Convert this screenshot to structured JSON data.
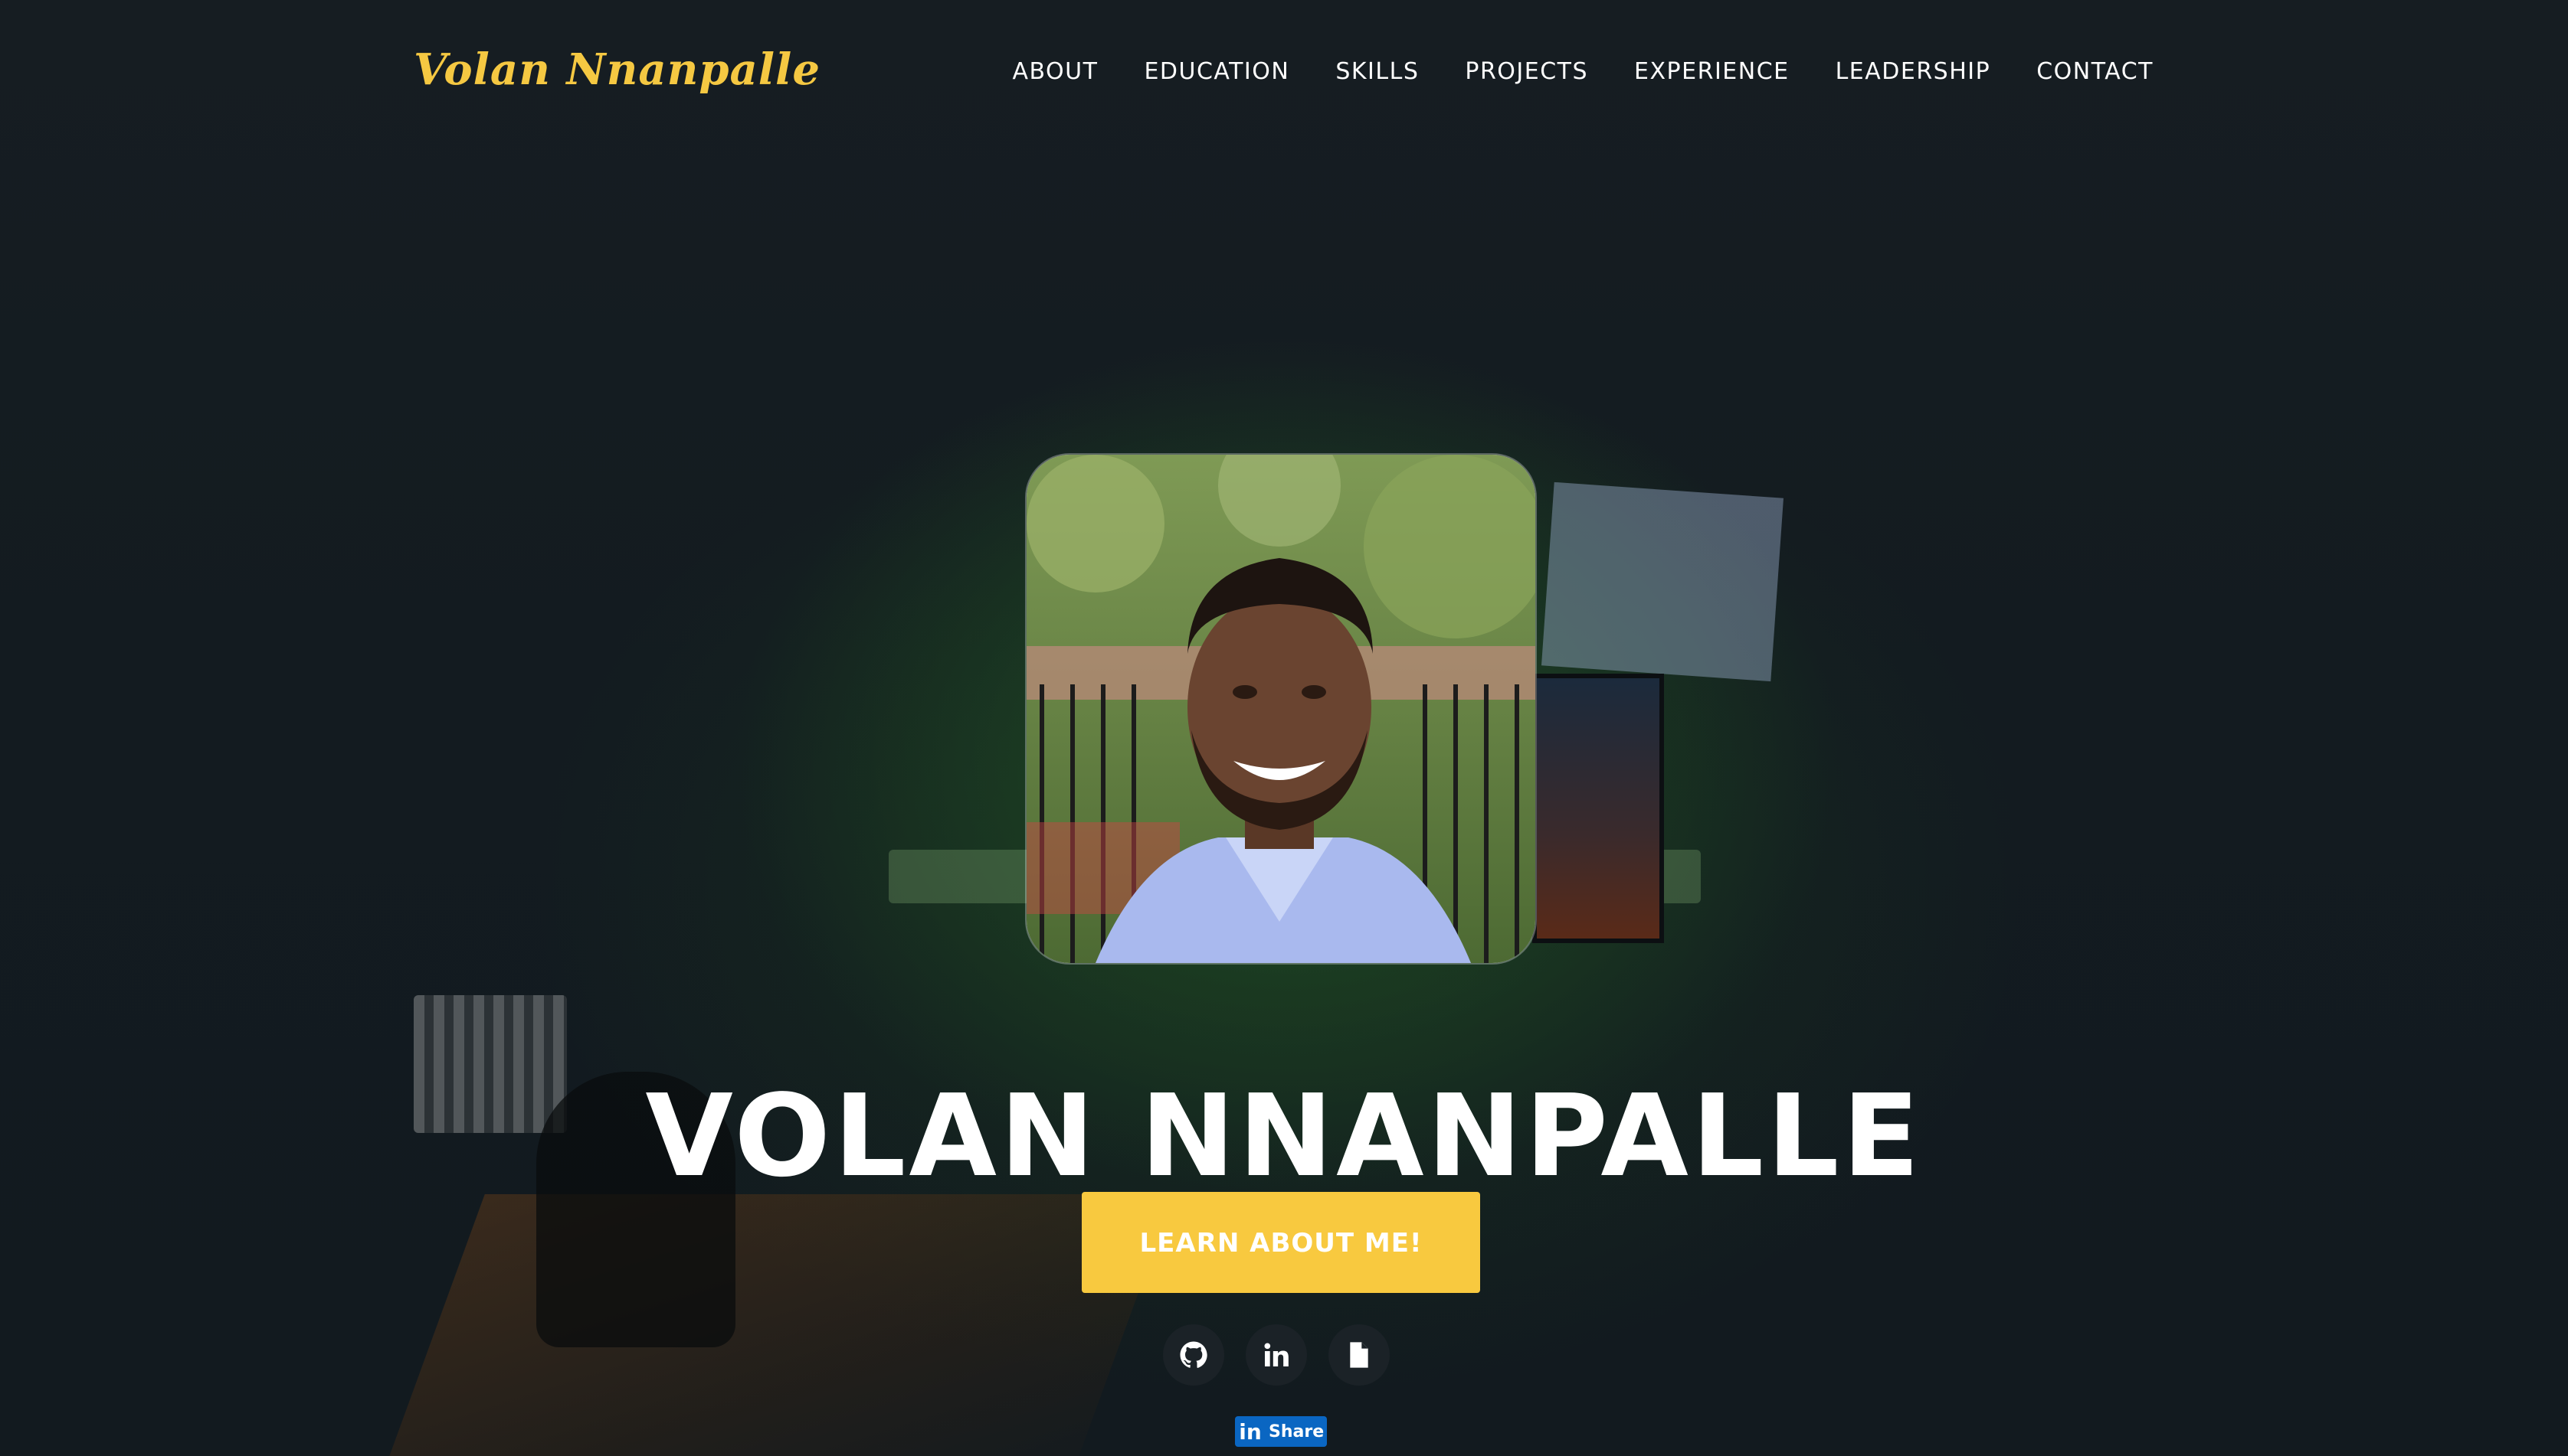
{
  "header": {
    "brand": "Volan Nnanpalle",
    "nav": [
      {
        "label": "ABOUT"
      },
      {
        "label": "EDUCATION"
      },
      {
        "label": "SKILLS"
      },
      {
        "label": "PROJECTS"
      },
      {
        "label": "EXPERIENCE"
      },
      {
        "label": "LEADERSHIP"
      },
      {
        "label": "CONTACT"
      }
    ]
  },
  "hero": {
    "portrait_icon": "profile-photo",
    "name": "VOLAN NNANPALLE",
    "cta_label": "LEARN ABOUT ME!",
    "social": [
      {
        "icon": "github-icon"
      },
      {
        "icon": "linkedin-icon"
      },
      {
        "icon": "document-icon"
      }
    ],
    "share": {
      "logo": "in",
      "label": "Share"
    }
  },
  "colors": {
    "accent": "#f8c93f",
    "brand": "#f5c842",
    "background": "#121a1f",
    "linkedin": "#0a66c2"
  }
}
